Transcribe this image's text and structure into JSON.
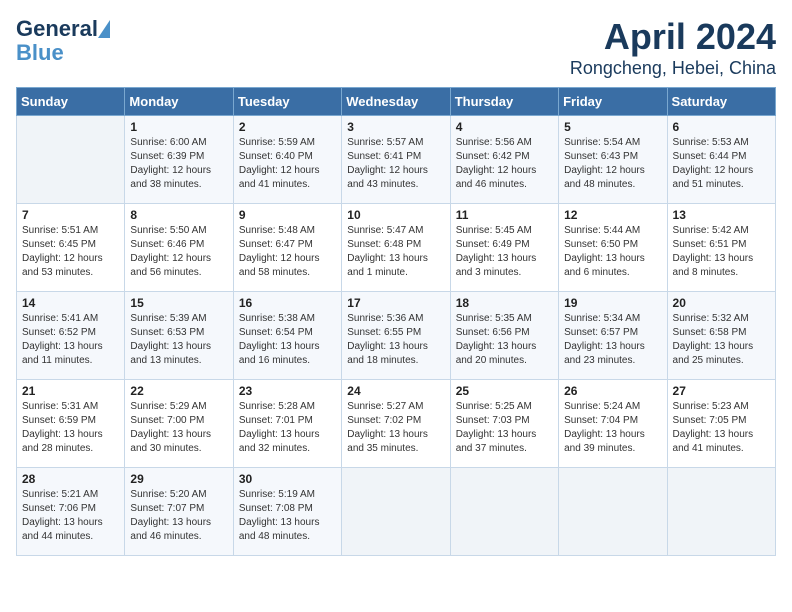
{
  "header": {
    "logo_general": "General",
    "logo_blue": "Blue",
    "month_title": "April 2024",
    "location": "Rongcheng, Hebei, China"
  },
  "days_of_week": [
    "Sunday",
    "Monday",
    "Tuesday",
    "Wednesday",
    "Thursday",
    "Friday",
    "Saturday"
  ],
  "weeks": [
    [
      {
        "day": "",
        "info": ""
      },
      {
        "day": "1",
        "info": "Sunrise: 6:00 AM\nSunset: 6:39 PM\nDaylight: 12 hours\nand 38 minutes."
      },
      {
        "day": "2",
        "info": "Sunrise: 5:59 AM\nSunset: 6:40 PM\nDaylight: 12 hours\nand 41 minutes."
      },
      {
        "day": "3",
        "info": "Sunrise: 5:57 AM\nSunset: 6:41 PM\nDaylight: 12 hours\nand 43 minutes."
      },
      {
        "day": "4",
        "info": "Sunrise: 5:56 AM\nSunset: 6:42 PM\nDaylight: 12 hours\nand 46 minutes."
      },
      {
        "day": "5",
        "info": "Sunrise: 5:54 AM\nSunset: 6:43 PM\nDaylight: 12 hours\nand 48 minutes."
      },
      {
        "day": "6",
        "info": "Sunrise: 5:53 AM\nSunset: 6:44 PM\nDaylight: 12 hours\nand 51 minutes."
      }
    ],
    [
      {
        "day": "7",
        "info": "Sunrise: 5:51 AM\nSunset: 6:45 PM\nDaylight: 12 hours\nand 53 minutes."
      },
      {
        "day": "8",
        "info": "Sunrise: 5:50 AM\nSunset: 6:46 PM\nDaylight: 12 hours\nand 56 minutes."
      },
      {
        "day": "9",
        "info": "Sunrise: 5:48 AM\nSunset: 6:47 PM\nDaylight: 12 hours\nand 58 minutes."
      },
      {
        "day": "10",
        "info": "Sunrise: 5:47 AM\nSunset: 6:48 PM\nDaylight: 13 hours\nand 1 minute."
      },
      {
        "day": "11",
        "info": "Sunrise: 5:45 AM\nSunset: 6:49 PM\nDaylight: 13 hours\nand 3 minutes."
      },
      {
        "day": "12",
        "info": "Sunrise: 5:44 AM\nSunset: 6:50 PM\nDaylight: 13 hours\nand 6 minutes."
      },
      {
        "day": "13",
        "info": "Sunrise: 5:42 AM\nSunset: 6:51 PM\nDaylight: 13 hours\nand 8 minutes."
      }
    ],
    [
      {
        "day": "14",
        "info": "Sunrise: 5:41 AM\nSunset: 6:52 PM\nDaylight: 13 hours\nand 11 minutes."
      },
      {
        "day": "15",
        "info": "Sunrise: 5:39 AM\nSunset: 6:53 PM\nDaylight: 13 hours\nand 13 minutes."
      },
      {
        "day": "16",
        "info": "Sunrise: 5:38 AM\nSunset: 6:54 PM\nDaylight: 13 hours\nand 16 minutes."
      },
      {
        "day": "17",
        "info": "Sunrise: 5:36 AM\nSunset: 6:55 PM\nDaylight: 13 hours\nand 18 minutes."
      },
      {
        "day": "18",
        "info": "Sunrise: 5:35 AM\nSunset: 6:56 PM\nDaylight: 13 hours\nand 20 minutes."
      },
      {
        "day": "19",
        "info": "Sunrise: 5:34 AM\nSunset: 6:57 PM\nDaylight: 13 hours\nand 23 minutes."
      },
      {
        "day": "20",
        "info": "Sunrise: 5:32 AM\nSunset: 6:58 PM\nDaylight: 13 hours\nand 25 minutes."
      }
    ],
    [
      {
        "day": "21",
        "info": "Sunrise: 5:31 AM\nSunset: 6:59 PM\nDaylight: 13 hours\nand 28 minutes."
      },
      {
        "day": "22",
        "info": "Sunrise: 5:29 AM\nSunset: 7:00 PM\nDaylight: 13 hours\nand 30 minutes."
      },
      {
        "day": "23",
        "info": "Sunrise: 5:28 AM\nSunset: 7:01 PM\nDaylight: 13 hours\nand 32 minutes."
      },
      {
        "day": "24",
        "info": "Sunrise: 5:27 AM\nSunset: 7:02 PM\nDaylight: 13 hours\nand 35 minutes."
      },
      {
        "day": "25",
        "info": "Sunrise: 5:25 AM\nSunset: 7:03 PM\nDaylight: 13 hours\nand 37 minutes."
      },
      {
        "day": "26",
        "info": "Sunrise: 5:24 AM\nSunset: 7:04 PM\nDaylight: 13 hours\nand 39 minutes."
      },
      {
        "day": "27",
        "info": "Sunrise: 5:23 AM\nSunset: 7:05 PM\nDaylight: 13 hours\nand 41 minutes."
      }
    ],
    [
      {
        "day": "28",
        "info": "Sunrise: 5:21 AM\nSunset: 7:06 PM\nDaylight: 13 hours\nand 44 minutes."
      },
      {
        "day": "29",
        "info": "Sunrise: 5:20 AM\nSunset: 7:07 PM\nDaylight: 13 hours\nand 46 minutes."
      },
      {
        "day": "30",
        "info": "Sunrise: 5:19 AM\nSunset: 7:08 PM\nDaylight: 13 hours\nand 48 minutes."
      },
      {
        "day": "",
        "info": ""
      },
      {
        "day": "",
        "info": ""
      },
      {
        "day": "",
        "info": ""
      },
      {
        "day": "",
        "info": ""
      }
    ]
  ]
}
